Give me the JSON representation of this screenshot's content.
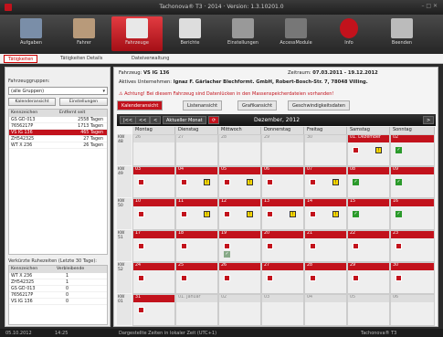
{
  "title": "Tachonova® T3 · 2014 · Version: 1.3.10201.0",
  "toolbar": [
    "Aufgaben",
    "Fahrer",
    "Fahrzeuge",
    "Berichte",
    "Einstellungen",
    "AccessModule",
    "Info",
    "Beenden"
  ],
  "subtabs": [
    "Tätigkeiten",
    "Tätigkeiten Details",
    "Dateiverwaltung"
  ],
  "left": {
    "group_label": "Fahrzeuggruppen:",
    "group_value": "(alle Gruppen)",
    "btn1": "Kalenderansicht",
    "btn2": "Einstellungen",
    "head": [
      "Kennzeichen",
      "Entfernt seit"
    ],
    "rows": [
      [
        "GS GD 013",
        "2558 Tagen"
      ],
      [
        "7656217P",
        "1713 Tagen"
      ],
      [
        "VS IG 136",
        "465 Tagen"
      ],
      [
        "ZH542325",
        "27 Tagen"
      ],
      [
        "WT X 236",
        "26 Tagen"
      ]
    ],
    "sub_label": "Verkürzte Ruhezeiten (Letzte 30 Tage):",
    "head2": [
      "Kennzeichen",
      "Verbleibende"
    ],
    "rows2": [
      [
        "WT X 236",
        "1"
      ],
      [
        "ZH542325",
        "1"
      ],
      [
        "GS GD 013",
        "0"
      ],
      [
        "7656217P",
        "0"
      ],
      [
        "VS IG 136",
        "0"
      ]
    ]
  },
  "right": {
    "vehicle_label": "Fahrzeug:",
    "vehicle": "VS IG 136",
    "period_label": "Zeitraum:",
    "period": "07.03.2011 - 19.12.2012",
    "company_label": "Aktives Unternehmen:",
    "company": "Ignaz F. Gärlacher Blechformt. GmbH, Robert-Bosch-Str. 7, 78048 Villing.",
    "warning": "Achtung! Bei diesem Fahrzeug sind Datenlücken in den Massenspeicherdateien vorhanden!",
    "tabs": [
      "Kalenderansicht",
      "Listenansicht",
      "Grafikansicht",
      "Geschwindigkeitsdaten"
    ],
    "nav": [
      "|<<",
      "<<",
      "<",
      "Aktueller Monat",
      ">"
    ],
    "month": "Dezember, 2012",
    "days": [
      "Montag",
      "Dienstag",
      "Mittwoch",
      "Donnerstag",
      "Freitag",
      "Samstag",
      "Sonntag"
    ],
    "weeks": [
      {
        "kw": "KW 48",
        "d": [
          "26",
          "27",
          "28",
          "29",
          "30",
          "01. Dezember",
          "02"
        ]
      },
      {
        "kw": "KW 49",
        "d": [
          "03",
          "04",
          "05",
          "06",
          "07",
          "08",
          "09"
        ]
      },
      {
        "kw": "KW 50",
        "d": [
          "10",
          "11",
          "12",
          "13",
          "14",
          "15",
          "16"
        ]
      },
      {
        "kw": "KW 51",
        "d": [
          "17",
          "18",
          "19",
          "20",
          "21",
          "22",
          "23"
        ]
      },
      {
        "kw": "KW 52",
        "d": [
          "24",
          "25",
          "26",
          "27",
          "28",
          "29",
          "30"
        ]
      },
      {
        "kw": "KW 01",
        "d": [
          "31",
          "01. Januar",
          "02",
          "03",
          "04",
          "05",
          "06"
        ]
      }
    ]
  },
  "status": {
    "date": "05.10.2012",
    "time": "14:25",
    "tz": "Dargestellte Zeiten in lokaler Zeit (UTC+1)",
    "brand": "Tachonova® T3"
  }
}
